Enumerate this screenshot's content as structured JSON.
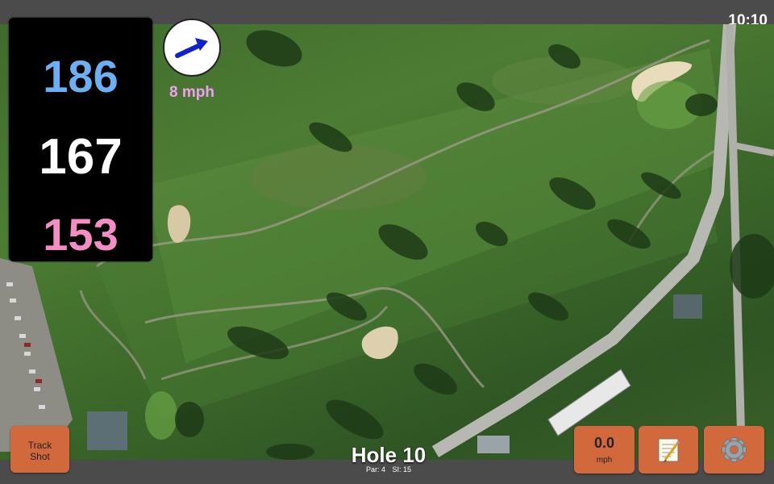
{
  "status_bar": {
    "time": "10:10"
  },
  "yardage": {
    "back": "186",
    "center": "167",
    "front": "153"
  },
  "wind": {
    "speed": "8 mph",
    "icon": "wind-arrow-icon"
  },
  "hole": {
    "title": "Hole 10",
    "par": "Par: 4",
    "si": "SI: 15"
  },
  "buttons": {
    "track_shot_line1": "Track",
    "track_shot_line2": "Shot",
    "speed_value": "0.0",
    "speed_unit": "mph",
    "notes_icon": "notepad-icon",
    "settings_icon": "gear-icon"
  },
  "colors": {
    "back_yardage": "#6ab0f2",
    "center_yardage": "#ffffff",
    "front_yardage": "#f48dc5",
    "button": "#d2693c",
    "wind_text": "#f0a0f0"
  }
}
